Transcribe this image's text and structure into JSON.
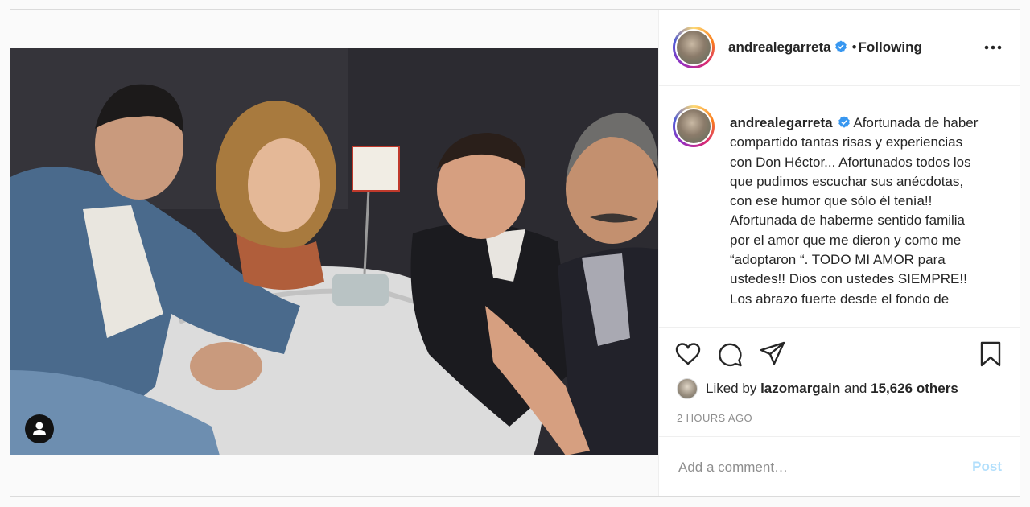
{
  "post": {
    "username": "andrealegarreta",
    "follow_separator": "•",
    "follow_status": "Following",
    "caption": "Afortunada de haber compartido tantas risas y experiencias con Don Héctor... Afortunados todos los que pudimos escuchar sus anécdotas, con ese humor que sólo él tenía!! Afortunada de haberme sentido familia por el amor que me dieron y como me “adoptaron “. TODO MI AMOR para ustedes!! Dios con ustedes SIEMPRE!! Los abrazo fuerte desde el fondo de",
    "likes": {
      "prefix": "Liked by",
      "liker": "lazomargain",
      "joiner": "and",
      "others": "15,626 others"
    },
    "timestamp": "2 HOURS AGO"
  },
  "comment": {
    "placeholder": "Add a comment…",
    "post_label": "Post"
  },
  "icons": {
    "verified": "verified-badge-icon",
    "more": "more-options-icon",
    "like": "heart-icon",
    "comment": "comment-icon",
    "share": "share-icon",
    "save": "bookmark-icon",
    "tagged": "user-tag-icon"
  },
  "colors": {
    "verified_blue": "#3897f0",
    "post_button": "#b2dffc",
    "text": "#262626",
    "muted": "#8e8e8e"
  }
}
